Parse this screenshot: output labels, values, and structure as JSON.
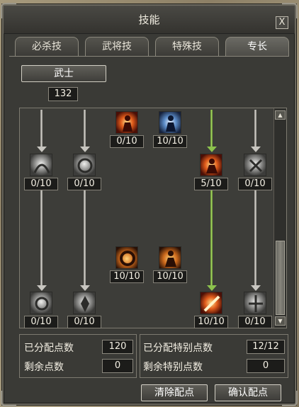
{
  "window": {
    "title": "技能",
    "close_label": "X"
  },
  "tabs": [
    {
      "label": "必杀技"
    },
    {
      "label": "武将技"
    },
    {
      "label": "特殊技"
    },
    {
      "label": "专长"
    }
  ],
  "class_button": {
    "label": "武士"
  },
  "points_value": "132",
  "skills": [
    {
      "name": "skill-fire-aura",
      "icon": "fire-aura-icon",
      "count": "0/10",
      "style": "red"
    },
    {
      "name": "skill-ice-aura",
      "icon": "ice-aura-icon",
      "count": "10/10",
      "style": "blue"
    },
    {
      "name": "skill-gray-1",
      "icon": "gray-skill-icon",
      "count": "0/10",
      "style": "gray"
    },
    {
      "name": "skill-gray-2",
      "icon": "gray-skill-icon",
      "count": "0/10",
      "style": "gray"
    },
    {
      "name": "skill-flame-warrior",
      "icon": "flame-warrior-icon",
      "count": "5/10",
      "style": "red"
    },
    {
      "name": "skill-gray-3",
      "icon": "gray-skill-icon",
      "count": "0/10",
      "style": "gray"
    },
    {
      "name": "skill-fire-ring",
      "icon": "fire-ring-icon",
      "count": "10/10",
      "style": "orange"
    },
    {
      "name": "skill-fire-summon",
      "icon": "fire-summon-icon",
      "count": "10/10",
      "style": "orange"
    },
    {
      "name": "skill-gray-4",
      "icon": "gray-skill-icon",
      "count": "0/10",
      "style": "gray"
    },
    {
      "name": "skill-gray-5",
      "icon": "gray-skill-icon",
      "count": "0/10",
      "style": "gray"
    },
    {
      "name": "skill-fire-blast",
      "icon": "fire-blast-icon",
      "count": "10/10",
      "style": "red"
    },
    {
      "name": "skill-gray-6",
      "icon": "gray-skill-icon",
      "count": "0/10",
      "style": "gray"
    }
  ],
  "stats": {
    "allocated_label": "已分配点数",
    "allocated_value": "120",
    "remaining_label": "剩余点数",
    "remaining_value": "0",
    "special_allocated_label": "已分配特别点数",
    "special_allocated_value": "12/12",
    "special_remaining_label": "剩余特别点数",
    "special_remaining_value": "0"
  },
  "buttons": {
    "clear": "清除配点",
    "confirm": "确认配点"
  },
  "colors": {
    "connector_gray": "#c8c6c0",
    "connector_green": "#8cc24d",
    "panel_bg": "#3a3a36"
  }
}
